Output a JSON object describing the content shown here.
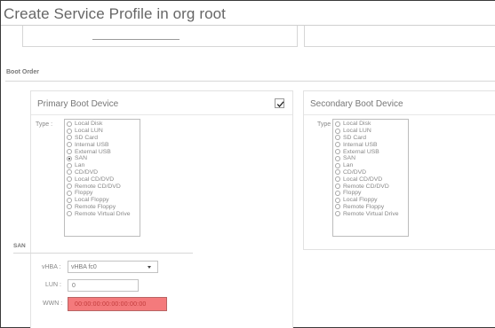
{
  "window": {
    "title": "Create Service Profile in org root"
  },
  "boot_order": {
    "section_title": "Boot Order",
    "primary": {
      "title": "Primary Boot Device",
      "checked": true,
      "type_label": "Type :",
      "options": [
        "Local Disk",
        "Local LUN",
        "SD Card",
        "Internal USB",
        "External USB",
        "SAN",
        "Lan",
        "CD/DVD",
        "Local CD/DVD",
        "Remote CD/DVD",
        "Floppy",
        "Local Floppy",
        "Remote Floppy",
        "Remote Virtual Drive"
      ],
      "selected": "SAN"
    },
    "secondary": {
      "title": "Secondary Boot Device",
      "type_label": "Type :",
      "options": [
        "Local Disk",
        "Local LUN",
        "SD Card",
        "Internal USB",
        "External USB",
        "SAN",
        "Lan",
        "CD/DVD",
        "Local CD/DVD",
        "Remote CD/DVD",
        "Floppy",
        "Local Floppy",
        "Remote Floppy",
        "Remote Virtual Drive"
      ],
      "selected": ""
    }
  },
  "san": {
    "title": "SAN",
    "vhba_label": "vHBA :",
    "vhba_value": "vHBA fc0",
    "lun_label": "LUN :",
    "lun_value": "0",
    "wwn_label": "WWN :",
    "wwn_value": "00:00:00:00:00:00:00:00",
    "error_color": "#f47a7c"
  },
  "icons": {
    "checkbox": "checkmark-icon",
    "dropdown": "chevron-down-icon",
    "radio": "radio-button-icon"
  }
}
